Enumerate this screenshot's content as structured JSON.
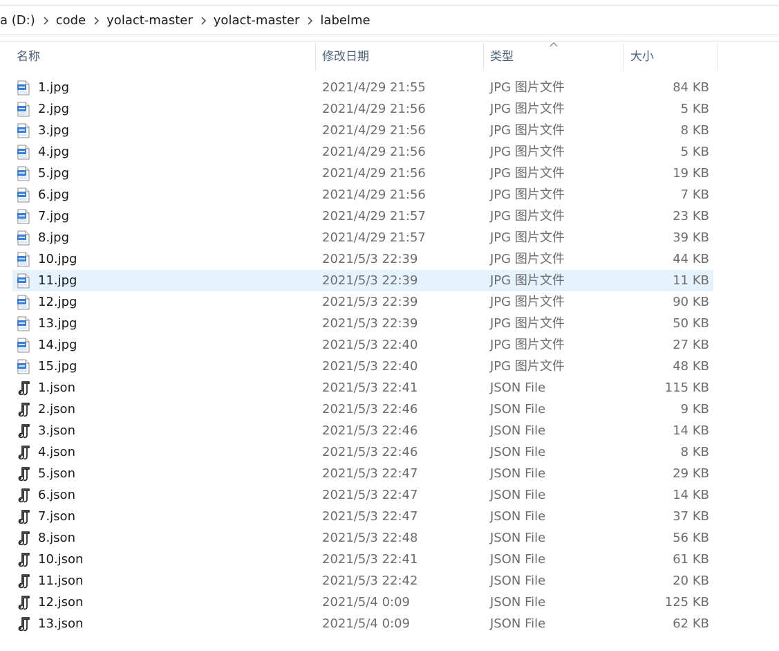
{
  "breadcrumb": {
    "items": [
      "a (D:)",
      "code",
      "yolact-master",
      "yolact-master",
      "labelme"
    ]
  },
  "columns": {
    "name": "名称",
    "date": "修改日期",
    "type": "类型",
    "size": "大小"
  },
  "colors": {
    "selection": "#e5f3ff",
    "header_text": "#4c607a",
    "secondary_text": "#6d6d6d"
  },
  "files": [
    {
      "name": "1.jpg",
      "date": "2021/4/29 21:55",
      "type": "JPG 图片文件",
      "size": "84 KB",
      "icon": "jpg-file-icon"
    },
    {
      "name": "2.jpg",
      "date": "2021/4/29 21:56",
      "type": "JPG 图片文件",
      "size": "5 KB",
      "icon": "jpg-file-icon"
    },
    {
      "name": "3.jpg",
      "date": "2021/4/29 21:56",
      "type": "JPG 图片文件",
      "size": "8 KB",
      "icon": "jpg-file-icon"
    },
    {
      "name": "4.jpg",
      "date": "2021/4/29 21:56",
      "type": "JPG 图片文件",
      "size": "5 KB",
      "icon": "jpg-file-icon"
    },
    {
      "name": "5.jpg",
      "date": "2021/4/29 21:56",
      "type": "JPG 图片文件",
      "size": "19 KB",
      "icon": "jpg-file-icon"
    },
    {
      "name": "6.jpg",
      "date": "2021/4/29 21:56",
      "type": "JPG 图片文件",
      "size": "7 KB",
      "icon": "jpg-file-icon"
    },
    {
      "name": "7.jpg",
      "date": "2021/4/29 21:57",
      "type": "JPG 图片文件",
      "size": "23 KB",
      "icon": "jpg-file-icon"
    },
    {
      "name": "8.jpg",
      "date": "2021/4/29 21:57",
      "type": "JPG 图片文件",
      "size": "39 KB",
      "icon": "jpg-file-icon"
    },
    {
      "name": "10.jpg",
      "date": "2021/5/3 22:39",
      "type": "JPG 图片文件",
      "size": "44 KB",
      "icon": "jpg-file-icon"
    },
    {
      "name": "11.jpg",
      "date": "2021/5/3 22:39",
      "type": "JPG 图片文件",
      "size": "11 KB",
      "icon": "jpg-file-icon",
      "selected": true
    },
    {
      "name": "12.jpg",
      "date": "2021/5/3 22:39",
      "type": "JPG 图片文件",
      "size": "90 KB",
      "icon": "jpg-file-icon"
    },
    {
      "name": "13.jpg",
      "date": "2021/5/3 22:39",
      "type": "JPG 图片文件",
      "size": "50 KB",
      "icon": "jpg-file-icon"
    },
    {
      "name": "14.jpg",
      "date": "2021/5/3 22:40",
      "type": "JPG 图片文件",
      "size": "27 KB",
      "icon": "jpg-file-icon"
    },
    {
      "name": "15.jpg",
      "date": "2021/5/3 22:40",
      "type": "JPG 图片文件",
      "size": "48 KB",
      "icon": "jpg-file-icon"
    },
    {
      "name": "1.json",
      "date": "2021/5/3 22:41",
      "type": "JSON File",
      "size": "115 KB",
      "icon": "json-file-icon"
    },
    {
      "name": "2.json",
      "date": "2021/5/3 22:46",
      "type": "JSON File",
      "size": "9 KB",
      "icon": "json-file-icon"
    },
    {
      "name": "3.json",
      "date": "2021/5/3 22:46",
      "type": "JSON File",
      "size": "14 KB",
      "icon": "json-file-icon"
    },
    {
      "name": "4.json",
      "date": "2021/5/3 22:46",
      "type": "JSON File",
      "size": "8 KB",
      "icon": "json-file-icon"
    },
    {
      "name": "5.json",
      "date": "2021/5/3 22:47",
      "type": "JSON File",
      "size": "29 KB",
      "icon": "json-file-icon"
    },
    {
      "name": "6.json",
      "date": "2021/5/3 22:47",
      "type": "JSON File",
      "size": "14 KB",
      "icon": "json-file-icon"
    },
    {
      "name": "7.json",
      "date": "2021/5/3 22:47",
      "type": "JSON File",
      "size": "37 KB",
      "icon": "json-file-icon"
    },
    {
      "name": "8.json",
      "date": "2021/5/3 22:48",
      "type": "JSON File",
      "size": "56 KB",
      "icon": "json-file-icon"
    },
    {
      "name": "10.json",
      "date": "2021/5/3 22:41",
      "type": "JSON File",
      "size": "61 KB",
      "icon": "json-file-icon"
    },
    {
      "name": "11.json",
      "date": "2021/5/3 22:42",
      "type": "JSON File",
      "size": "20 KB",
      "icon": "json-file-icon"
    },
    {
      "name": "12.json",
      "date": "2021/5/4 0:09",
      "type": "JSON File",
      "size": "125 KB",
      "icon": "json-file-icon"
    },
    {
      "name": "13.json",
      "date": "2021/5/4 0:09",
      "type": "JSON File",
      "size": "62 KB",
      "icon": "json-file-icon"
    }
  ]
}
